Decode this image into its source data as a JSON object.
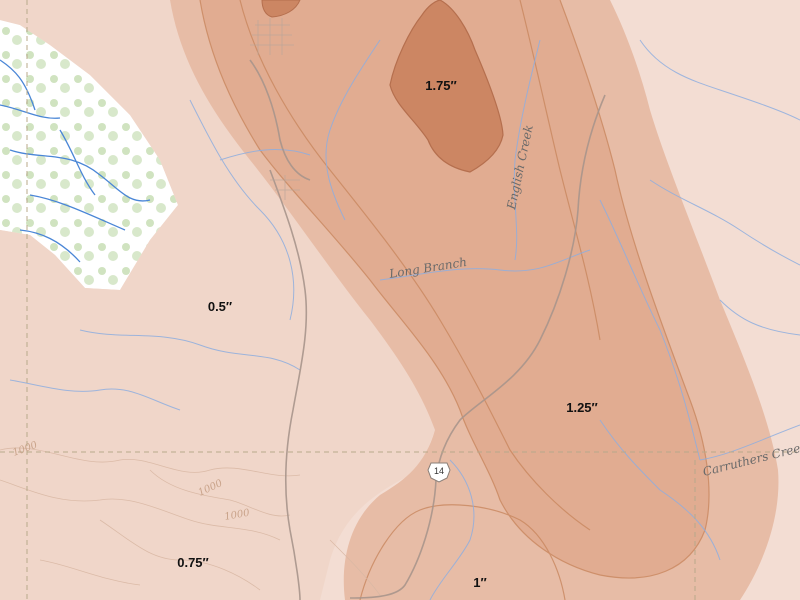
{
  "map": {
    "colors": {
      "background": "#f3ddd3",
      "band_0_75": "#efd4c6",
      "band_1": "#e6b9a1",
      "band_1_25": "#dca487",
      "band_1_75": "#cc8663",
      "contour_line": "#c4805e",
      "water": "#6f9fd8",
      "terrain_green": "#bcd6a4",
      "road": "#a8958c",
      "grid_dash": "#b8a98a"
    },
    "precip_labels": [
      "0.5″",
      "0.75″",
      "1″",
      "1.25″",
      "1.75″"
    ],
    "streams": [
      "Long Branch",
      "English Creek",
      "Carruthers Creek"
    ],
    "contour_labels": [
      "1000",
      "1000",
      "1000"
    ],
    "route_shield": "14"
  }
}
